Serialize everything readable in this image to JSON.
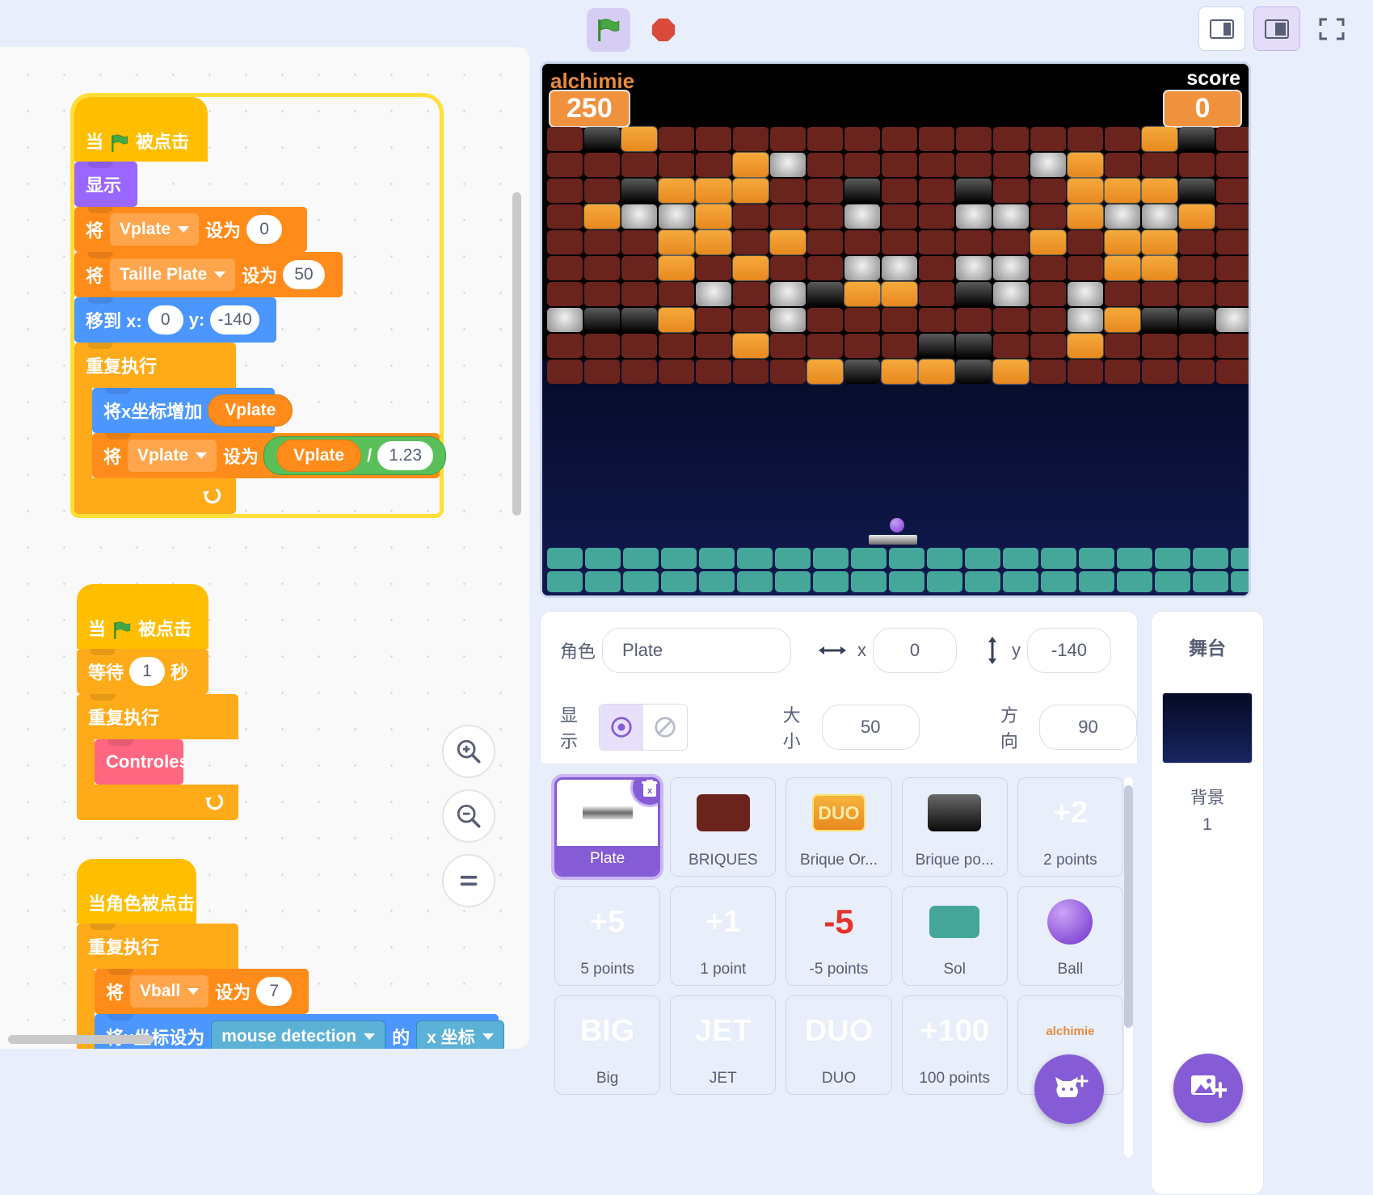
{
  "toolbar": {
    "green_flag_icon": "green-flag-icon",
    "stop_icon": "stop-sign-icon",
    "small_stage_icon": "small-stage-layout-icon",
    "large_stage_icon": "large-stage-layout-icon",
    "fullscreen_icon": "fullscreen-icon"
  },
  "code": {
    "scripts": [
      {
        "id": "script1",
        "glowing": true,
        "blocks": [
          {
            "type": "hat",
            "category": "events",
            "text_before": "当",
            "icon": "green-flag-icon",
            "text_after": "被点击"
          },
          {
            "type": "stack",
            "category": "looks",
            "label": "显示"
          },
          {
            "type": "stack",
            "category": "vars",
            "label": "将",
            "dropdown": "Vplate",
            "label2": "设为",
            "value": "0"
          },
          {
            "type": "stack",
            "category": "vars",
            "label": "将",
            "dropdown": "Taille Plate",
            "label2": "设为",
            "value": "50"
          },
          {
            "type": "stack",
            "category": "motion",
            "label": "移到 x:",
            "value": "0",
            "label2": "y:",
            "value2": "-140"
          },
          {
            "type": "c",
            "category": "control",
            "label": "重复执行",
            "children": [
              {
                "type": "stack",
                "category": "motion",
                "label": "将x坐标增加",
                "var": "Vplate"
              },
              {
                "type": "stack",
                "category": "vars",
                "label": "将",
                "dropdown": "Vplate",
                "label2": "设为",
                "operator": {
                  "left": "Vplate",
                  "op": "/",
                  "right": "1.23"
                }
              }
            ]
          }
        ]
      },
      {
        "id": "script2",
        "glowing": false,
        "blocks": [
          {
            "type": "hat",
            "category": "events",
            "text_before": "当",
            "icon": "green-flag-icon",
            "text_after": "被点击"
          },
          {
            "type": "stack",
            "category": "control",
            "label": "等待",
            "value": "1",
            "label2": "秒"
          },
          {
            "type": "c",
            "category": "control",
            "label": "重复执行",
            "children": [
              {
                "type": "stack",
                "category": "custom",
                "label": "Controles"
              }
            ]
          }
        ]
      },
      {
        "id": "script3",
        "glowing": false,
        "blocks": [
          {
            "type": "hat",
            "category": "events",
            "label": "当角色被点击"
          },
          {
            "type": "c",
            "category": "control",
            "label": "重复执行",
            "children": [
              {
                "type": "stack",
                "category": "vars",
                "label": "将",
                "dropdown": "Vball",
                "label2": "设为",
                "value": "7"
              },
              {
                "type": "stack",
                "category": "motion",
                "label": "将x坐标设为",
                "dropdown": "mouse detection",
                "label2": "的",
                "dropdown2": "x 坐标"
              }
            ]
          }
        ]
      }
    ],
    "zoom_in_icon": "zoom-in-icon",
    "zoom_out_icon": "zoom-out-icon",
    "zoom_reset_icon": "zoom-reset-icon"
  },
  "stage": {
    "game_title": "alchimie",
    "left_badge": "250",
    "score_label": "score",
    "score_value": "0",
    "brick_rows": [
      [
        "red",
        "black",
        "orange",
        "red",
        "red",
        "red",
        "red",
        "red",
        "red",
        "red",
        "red",
        "red",
        "red",
        "red",
        "red",
        "red",
        "orange",
        "black",
        "red",
        "red"
      ],
      [
        "red",
        "red",
        "red",
        "red",
        "red",
        "orange",
        "silver",
        "red",
        "red",
        "red",
        "red",
        "red",
        "red",
        "silver",
        "orange",
        "red",
        "red",
        "red",
        "red",
        "red"
      ],
      [
        "red",
        "red",
        "black",
        "orange",
        "orange",
        "orange",
        "red",
        "red",
        "black",
        "red",
        "red",
        "black",
        "red",
        "red",
        "orange",
        "orange",
        "orange",
        "black",
        "red",
        "red"
      ],
      [
        "red",
        "orange",
        "silver",
        "silver",
        "orange",
        "red",
        "red",
        "red",
        "silver",
        "red",
        "red",
        "silver",
        "silver",
        "red",
        "orange",
        "silver",
        "silver",
        "orange",
        "red",
        "red"
      ],
      [
        "red",
        "red",
        "red",
        "orange",
        "orange",
        "red",
        "orange",
        "red",
        "red",
        "red",
        "red",
        "red",
        "red",
        "orange",
        "red",
        "orange",
        "orange",
        "red",
        "red",
        "red"
      ],
      [
        "red",
        "red",
        "red",
        "orange",
        "red",
        "orange",
        "red",
        "red",
        "silver",
        "silver",
        "red",
        "silver",
        "silver",
        "red",
        "red",
        "orange",
        "orange",
        "red",
        "red",
        "red"
      ],
      [
        "red",
        "red",
        "red",
        "red",
        "silver",
        "red",
        "silver",
        "black",
        "orange",
        "orange",
        "red",
        "black",
        "silver",
        "red",
        "silver",
        "red",
        "red",
        "red",
        "red",
        "red"
      ],
      [
        "silver",
        "black",
        "black",
        "orange",
        "red",
        "red",
        "silver",
        "red",
        "red",
        "red",
        "red",
        "red",
        "red",
        "red",
        "silver",
        "orange",
        "black",
        "black",
        "silver",
        "red"
      ],
      [
        "red",
        "red",
        "red",
        "red",
        "red",
        "orange",
        "red",
        "red",
        "red",
        "red",
        "black",
        "black",
        "red",
        "red",
        "orange",
        "red",
        "red",
        "red",
        "red",
        "red"
      ],
      [
        "red",
        "red",
        "red",
        "red",
        "red",
        "red",
        "red",
        "orange",
        "black",
        "orange",
        "orange",
        "black",
        "orange",
        "red",
        "red",
        "red",
        "red",
        "red",
        "red",
        "red"
      ]
    ],
    "sol_count": 40
  },
  "sprite_info": {
    "name_label": "角色",
    "name_value": "Plate",
    "x_label": "x",
    "x_value": "0",
    "y_label": "y",
    "y_value": "-140",
    "show_label": "显示",
    "show_icon": "eye-visible-icon",
    "hide_icon": "eye-hidden-icon",
    "size_label": "大小",
    "size_value": "50",
    "direction_label": "方向",
    "direction_value": "90",
    "x_arrow_icon": "horizontal-arrows-icon",
    "y_arrow_icon": "vertical-arrows-icon"
  },
  "sprites": [
    {
      "name": "Plate",
      "thumb_type": "plate",
      "selected": true
    },
    {
      "name": "BRIQUES",
      "thumb_type": "brick-red",
      "selected": false
    },
    {
      "name": "Brique Or...",
      "thumb_type": "brick-duo",
      "thumb_text": "DUO",
      "selected": false
    },
    {
      "name": "Brique po...",
      "thumb_type": "brick-black",
      "selected": false
    },
    {
      "name": "2 points",
      "thumb_type": "text",
      "thumb_text": "+2",
      "selected": false
    },
    {
      "name": "5 points",
      "thumb_type": "text",
      "thumb_text": "+5",
      "selected": false
    },
    {
      "name": "1 point",
      "thumb_type": "text",
      "thumb_text": "+1",
      "selected": false
    },
    {
      "name": "-5 points",
      "thumb_type": "text-red",
      "thumb_text": "-5",
      "selected": false
    },
    {
      "name": "Sol",
      "thumb_type": "sol",
      "selected": false
    },
    {
      "name": "Ball",
      "thumb_type": "ball",
      "selected": false
    },
    {
      "name": "Big",
      "thumb_type": "text",
      "thumb_text": "BIG",
      "selected": false
    },
    {
      "name": "JET",
      "thumb_type": "text",
      "thumb_text": "JET",
      "selected": false
    },
    {
      "name": "DUO",
      "thumb_type": "text",
      "thumb_text": "DUO",
      "selected": false
    },
    {
      "name": "100 points",
      "thumb_type": "text",
      "thumb_text": "+100",
      "selected": false
    },
    {
      "name": "alchim...",
      "thumb_type": "text-small-orange",
      "thumb_text": "alchimie",
      "selected": false
    }
  ],
  "stage_panel": {
    "title": "舞台",
    "backdrop_label": "背景",
    "backdrop_count": "1",
    "add_backdrop_icon": "add-backdrop-icon"
  },
  "sprite_actions": {
    "delete_icon": "trash-delete-icon",
    "add_sprite_icon": "add-sprite-cat-icon"
  },
  "colors": {
    "events": "#ffbf00",
    "looks": "#9966ff",
    "variables": "#ff8c1a",
    "motion": "#4c97ff",
    "control": "#ffab19",
    "custom": "#ff6680",
    "sensing": "#5cb1d6",
    "operators": "#59c059",
    "accent": "#855cd6"
  }
}
